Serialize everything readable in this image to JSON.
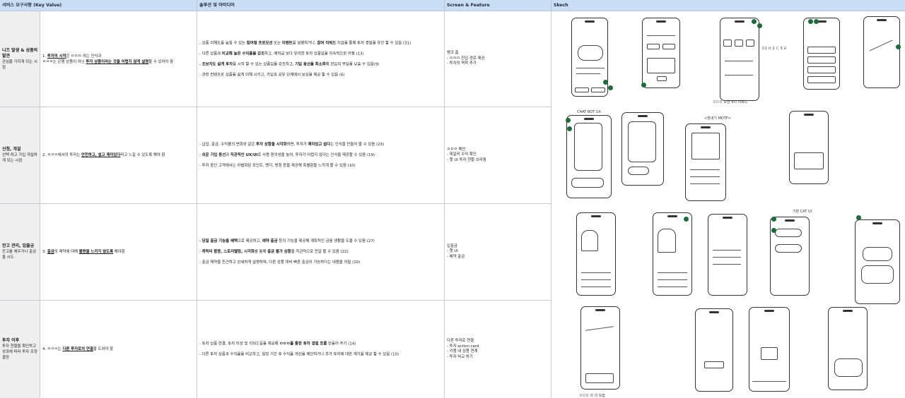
{
  "headers": {
    "requirement": "서비스 요구사항 (Key Value)",
    "solution": "솔루션 및 아이디어",
    "screen": "Screen & Feature",
    "sketch": "Skech"
  },
  "rows": [
    {
      "title": "니즈 발생 & 상품의 발견",
      "desc": "관심을 가지게 되는 시점",
      "req_num": "1.",
      "req_bold": "투자의 시작",
      "req_rest1": "은 ㅁㅁㅁ 라는 인식과",
      "req_line2a": "ㅁㅁㅁ는 은행 상품이 아닌",
      "req_bold2": "투자 상품이라는 것을 어렵지 않게 설명",
      "req_line2b": "할 수 있어야 함",
      "solutions": [
        {
          "a": "- 상품 이해도를 높일 수 있는 ",
          "b": "참여형 프로모션",
          "c": " 또는 ",
          "d": "이벤트",
          "e": "를 실행하거나, ",
          "f": "참여 리워드",
          "g": " 지급을 통해 투자 경험을 유인 할 수 있음 (31)"
        },
        {
          "a": "- 다른 상품과 ",
          "b": "비교해 높은 수익률을 강조",
          "c": "하고, 예적금 보다 유리한 투자 상품임을 지속적으로 어필 (13)"
        },
        {
          "a": "- ",
          "b": "초보자도 쉽게 투자",
          "c": "를 시작 할 수 있는 상품임을 강조하고, ",
          "d": "기입 동선을 최소화",
          "e": "해 진입의 부담을 낮출 수 있음(9)"
        },
        {
          "a": "- 관련 컨텐츠로 상품을 쉽게 이해 시키고, 가입과 공유 단계에서 보상을 제공 할 수 있음 (6)"
        }
      ],
      "screen": [
        "뱅크 홈",
        "- ㅁㅁㅁ 진입 경로 제공",
        "- 투자의 역학 추가"
      ]
    },
    {
      "title": "신청, 개설",
      "desc": "선택 하고 가입 개설하게 되는 시점",
      "req_num": "2.",
      "req_pre": "ㅁㅁㅁ에서의 투자는 ",
      "req_bold": "안전하고, 쉽고 재미있다",
      "req_rest1": "라고 느낄 수 있도록 해야 함",
      "solutions": [
        {
          "a": "- 납입, 출금, 수익률의 변화와 같은 ",
          "b": "투자 상황을 시각화",
          "c": "하면, 투자가 ",
          "d": "재미있고 쉽다",
          "e": "는 인식을 만들어 줄 수 있음 (23)"
        },
        {
          "a": "- ",
          "b": "쉬운 기입 동선",
          "c": "과 ",
          "d": "직관적인 UX/UI",
          "e": "로 사용 편의성을 높여, 투자가 어렵지 않다는 인식을 제공할 수 있음 (19)"
        },
        {
          "a": "- 투자 중인 고객에서는 차별화된 포인트, 뱃지, 벙칭 등을 제공해 특별함을 느끼게 할 수 있음 (10)"
        }
      ],
      "screen": [
        "ㅁㅁㅁ 메인",
        "- 데일리 수익 확인",
        "- 챗 UI 투자 현황 브리핑"
      ]
    },
    {
      "title": "잔고 관리, 입출금",
      "desc": "잔고를 채우거나 출금을 시도",
      "req_num": "3.",
      "req_bold": "출금",
      "req_rest1": "의 제약에 대해 ",
      "req_bold2": "불편을 느끼지 않도록",
      "req_line2b": " 해야함",
      "solutions": [
        {
          "a": "- ",
          "b": "당일 출금 기능을 혜택",
          "c": "으로 제공하고, ",
          "d": "예약 출금",
          "e": " 등의 기능을 제공해 계획적인 금융 생활을 도울 수 있음 (27)"
        },
        {
          "a": "- ",
          "b": "캐릭터 활용, 스토리텔링, 시각화",
          "c": "를 통해 ",
          "d": "출금 불가 상황",
          "e": "을 직관적으로 전달 할 수 있음 (22)"
        },
        {
          "a": "- 출금 제약을 친근하고 상세하게 설명하며, 다른 상품 대비 빠른 출금이 가능하다는 내용을 어필 (10)"
        }
      ],
      "screen": [
        "입출금",
        "- 챗 UI",
        "- 예약 출금"
      ]
    },
    {
      "title": "투자 이후",
      "desc": "투자 현황을 확인하고 성과에 따라 투자 조정 결정",
      "req_num": "4.",
      "req_pre": "ㅁㅁㅁ는 ",
      "req_bold": "다른 투자로의 연결",
      "req_rest1": "을 도와야 함",
      "solutions": [
        {
          "a": "- 투자 상품 연결, 투자 미션 및 리워드등을 제공해 ",
          "b": "ㅁㅁㅁ를 통한 투자 경험 흐름",
          "c": " 만들어 주기 (14)"
        },
        {
          "a": "- 다른 투자 상품과 수익률을 비교하고, 일정 기간 후 수익률 개선을 제안하거나 추가 투자에 대한 계기를 제공 할 수 있음 (10)"
        }
      ],
      "screen": [
        "다른 투자로 연결",
        "- 투자 action card",
        "- 키캠 내 상품 연계",
        "- 투자 비교 하기"
      ]
    }
  ],
  "sketch": {
    "notes": [
      "100, 6만원",
      "ㅁㅁㅁ 오전 9시 리워드",
      "ㅁ1 ㅂ 2 ㄷ 3 ㄹ",
      "CHAT BOT UX",
      "<장내기 MOTF>",
      "기본 CAT UI",
      "출금 불가 3",
      "Y천원 예약",
      "ㅁㅁㅁ 의 의 모습"
    ]
  }
}
